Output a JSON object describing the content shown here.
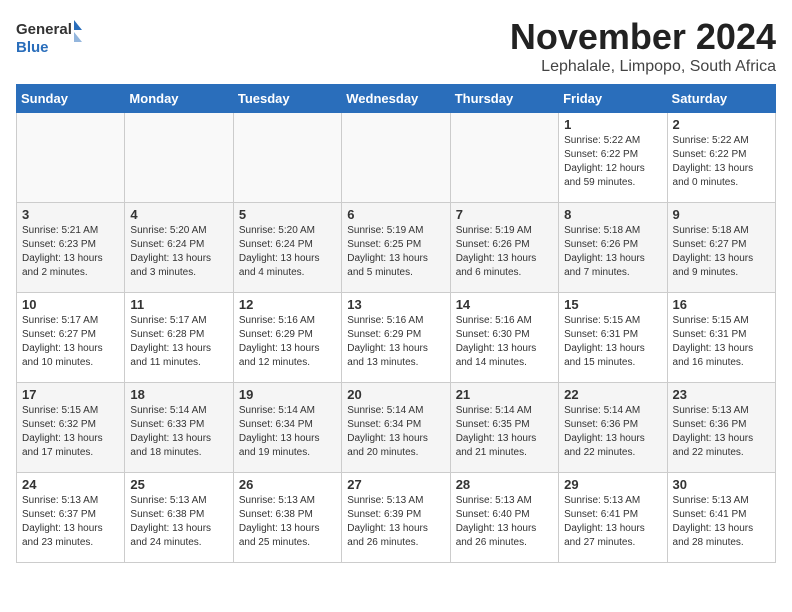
{
  "logo": {
    "text_general": "General",
    "text_blue": "Blue"
  },
  "title": "November 2024",
  "location": "Lephalale, Limpopo, South Africa",
  "weekdays": [
    "Sunday",
    "Monday",
    "Tuesday",
    "Wednesday",
    "Thursday",
    "Friday",
    "Saturday"
  ],
  "weeks": [
    [
      {
        "day": "",
        "info": ""
      },
      {
        "day": "",
        "info": ""
      },
      {
        "day": "",
        "info": ""
      },
      {
        "day": "",
        "info": ""
      },
      {
        "day": "",
        "info": ""
      },
      {
        "day": "1",
        "info": "Sunrise: 5:22 AM\nSunset: 6:22 PM\nDaylight: 12 hours\nand 59 minutes."
      },
      {
        "day": "2",
        "info": "Sunrise: 5:22 AM\nSunset: 6:22 PM\nDaylight: 13 hours\nand 0 minutes."
      }
    ],
    [
      {
        "day": "3",
        "info": "Sunrise: 5:21 AM\nSunset: 6:23 PM\nDaylight: 13 hours\nand 2 minutes."
      },
      {
        "day": "4",
        "info": "Sunrise: 5:20 AM\nSunset: 6:24 PM\nDaylight: 13 hours\nand 3 minutes."
      },
      {
        "day": "5",
        "info": "Sunrise: 5:20 AM\nSunset: 6:24 PM\nDaylight: 13 hours\nand 4 minutes."
      },
      {
        "day": "6",
        "info": "Sunrise: 5:19 AM\nSunset: 6:25 PM\nDaylight: 13 hours\nand 5 minutes."
      },
      {
        "day": "7",
        "info": "Sunrise: 5:19 AM\nSunset: 6:26 PM\nDaylight: 13 hours\nand 6 minutes."
      },
      {
        "day": "8",
        "info": "Sunrise: 5:18 AM\nSunset: 6:26 PM\nDaylight: 13 hours\nand 7 minutes."
      },
      {
        "day": "9",
        "info": "Sunrise: 5:18 AM\nSunset: 6:27 PM\nDaylight: 13 hours\nand 9 minutes."
      }
    ],
    [
      {
        "day": "10",
        "info": "Sunrise: 5:17 AM\nSunset: 6:27 PM\nDaylight: 13 hours\nand 10 minutes."
      },
      {
        "day": "11",
        "info": "Sunrise: 5:17 AM\nSunset: 6:28 PM\nDaylight: 13 hours\nand 11 minutes."
      },
      {
        "day": "12",
        "info": "Sunrise: 5:16 AM\nSunset: 6:29 PM\nDaylight: 13 hours\nand 12 minutes."
      },
      {
        "day": "13",
        "info": "Sunrise: 5:16 AM\nSunset: 6:29 PM\nDaylight: 13 hours\nand 13 minutes."
      },
      {
        "day": "14",
        "info": "Sunrise: 5:16 AM\nSunset: 6:30 PM\nDaylight: 13 hours\nand 14 minutes."
      },
      {
        "day": "15",
        "info": "Sunrise: 5:15 AM\nSunset: 6:31 PM\nDaylight: 13 hours\nand 15 minutes."
      },
      {
        "day": "16",
        "info": "Sunrise: 5:15 AM\nSunset: 6:31 PM\nDaylight: 13 hours\nand 16 minutes."
      }
    ],
    [
      {
        "day": "17",
        "info": "Sunrise: 5:15 AM\nSunset: 6:32 PM\nDaylight: 13 hours\nand 17 minutes."
      },
      {
        "day": "18",
        "info": "Sunrise: 5:14 AM\nSunset: 6:33 PM\nDaylight: 13 hours\nand 18 minutes."
      },
      {
        "day": "19",
        "info": "Sunrise: 5:14 AM\nSunset: 6:34 PM\nDaylight: 13 hours\nand 19 minutes."
      },
      {
        "day": "20",
        "info": "Sunrise: 5:14 AM\nSunset: 6:34 PM\nDaylight: 13 hours\nand 20 minutes."
      },
      {
        "day": "21",
        "info": "Sunrise: 5:14 AM\nSunset: 6:35 PM\nDaylight: 13 hours\nand 21 minutes."
      },
      {
        "day": "22",
        "info": "Sunrise: 5:14 AM\nSunset: 6:36 PM\nDaylight: 13 hours\nand 22 minutes."
      },
      {
        "day": "23",
        "info": "Sunrise: 5:13 AM\nSunset: 6:36 PM\nDaylight: 13 hours\nand 22 minutes."
      }
    ],
    [
      {
        "day": "24",
        "info": "Sunrise: 5:13 AM\nSunset: 6:37 PM\nDaylight: 13 hours\nand 23 minutes."
      },
      {
        "day": "25",
        "info": "Sunrise: 5:13 AM\nSunset: 6:38 PM\nDaylight: 13 hours\nand 24 minutes."
      },
      {
        "day": "26",
        "info": "Sunrise: 5:13 AM\nSunset: 6:38 PM\nDaylight: 13 hours\nand 25 minutes."
      },
      {
        "day": "27",
        "info": "Sunrise: 5:13 AM\nSunset: 6:39 PM\nDaylight: 13 hours\nand 26 minutes."
      },
      {
        "day": "28",
        "info": "Sunrise: 5:13 AM\nSunset: 6:40 PM\nDaylight: 13 hours\nand 26 minutes."
      },
      {
        "day": "29",
        "info": "Sunrise: 5:13 AM\nSunset: 6:41 PM\nDaylight: 13 hours\nand 27 minutes."
      },
      {
        "day": "30",
        "info": "Sunrise: 5:13 AM\nSunset: 6:41 PM\nDaylight: 13 hours\nand 28 minutes."
      }
    ]
  ]
}
